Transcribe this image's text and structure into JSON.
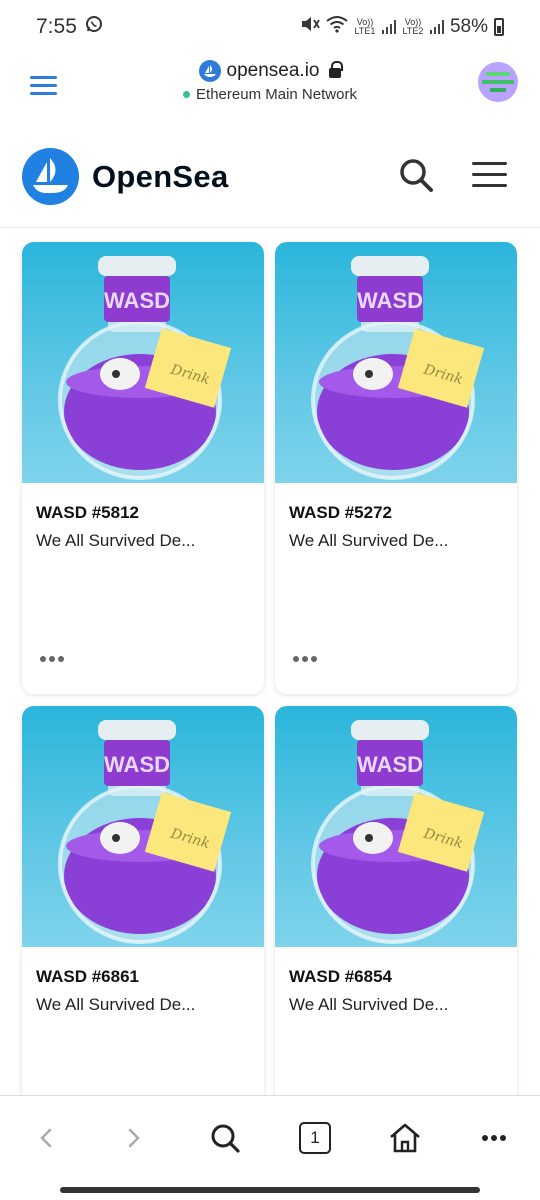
{
  "status_bar": {
    "time": "7:55",
    "sim1_label": "Vo)) LTE1",
    "sim2_label": "Vo)) LTE2",
    "battery": "58%",
    "icons": [
      "whatsapp-icon",
      "mute-icon",
      "wifi-icon",
      "signal-icon",
      "battery-icon"
    ]
  },
  "wallet": {
    "site": "opensea.io",
    "network": "Ethereum Main Network",
    "network_status_color": "#37c08b",
    "accent_color": "#2f7bd9"
  },
  "site_header": {
    "brand": "OpenSea",
    "brand_color": "#2081e2"
  },
  "cards": [
    {
      "title": "WASD #5812",
      "collection": "We All Survived De..."
    },
    {
      "title": "WASD #5272",
      "collection": "We All Survived De..."
    },
    {
      "title": "WASD #6861",
      "collection": "We All Survived De..."
    },
    {
      "title": "WASD #6854",
      "collection": "We All Survived De..."
    }
  ],
  "nft_image": {
    "bottle_label": "WASD",
    "note_text": "Drink"
  },
  "browser_nav": {
    "tab_count": "1",
    "icons": [
      "back-icon",
      "forward-icon",
      "search-icon",
      "tabs-icon",
      "home-icon",
      "more-icon"
    ]
  }
}
